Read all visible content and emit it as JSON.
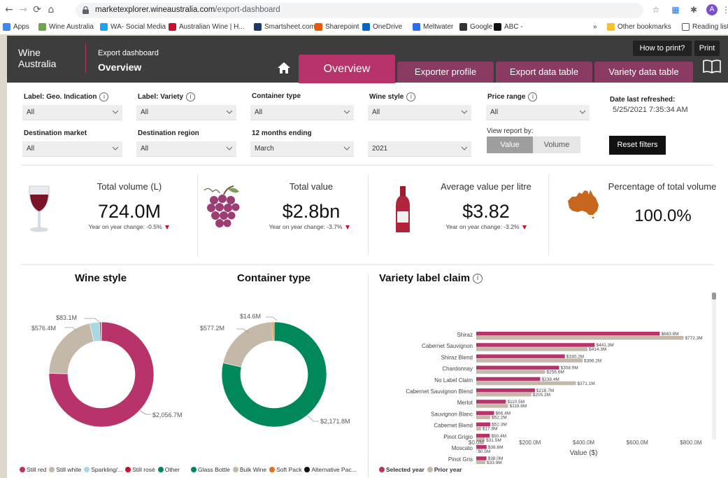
{
  "browser": {
    "url_host": "marketexplorer.wineaustralia.com",
    "url_path": "/export-dashboard",
    "profile_initial": "A",
    "bookmarks": [
      {
        "label": "Apps",
        "color": "#4285f4"
      },
      {
        "label": "Wine Australia",
        "color": "#6aa84f"
      },
      {
        "label": "WA- Social Media",
        "color": "#1da1f2"
      },
      {
        "label": "Australian Wine | H...",
        "color": "#c8102e"
      },
      {
        "label": "Smartsheet.com",
        "color": "#1b3a6b"
      },
      {
        "label": "Sharepoint",
        "color": "#e8590c"
      },
      {
        "label": "OneDrive",
        "color": "#0a64c8"
      },
      {
        "label": "Meltwater",
        "color": "#2b6cf0"
      },
      {
        "label": "Google",
        "color": "#333333"
      },
      {
        "label": "ABC -",
        "color": "#111111"
      }
    ],
    "overflow": "»",
    "other_bookmarks": "Other bookmarks",
    "reading_list": "Reading list"
  },
  "header": {
    "logo_line1": "Wine",
    "logo_line2": "Australia",
    "subtitle": "Export dashboard",
    "title": "Overview",
    "how_to_print": "How to print?",
    "print": "Print",
    "tabs": [
      "Overview",
      "Exporter profile",
      "Export data table",
      "Variety data table"
    ]
  },
  "filters": {
    "geo": {
      "label": "Label: Geo. Indication",
      "value": "All"
    },
    "variety": {
      "label": "Label: Variety",
      "value": "All"
    },
    "container": {
      "label": "Container type",
      "value": "All"
    },
    "wine_style": {
      "label": "Wine style",
      "value": "All"
    },
    "price": {
      "label": "Price range",
      "value": "All"
    },
    "date_label": "Date last refreshed:",
    "date_value": "5/25/2021 7:35:34 AM",
    "market": {
      "label": "Destination market",
      "value": "All"
    },
    "region": {
      "label": "Destination region",
      "value": "All"
    },
    "months": {
      "label": "12 months ending",
      "value": "March"
    },
    "year": {
      "value": "2021"
    },
    "view_label": "View report by:",
    "view_value": "Value",
    "view_volume": "Volume",
    "reset": "Reset filters"
  },
  "kpis": {
    "volume": {
      "title": "Total volume (L)",
      "value": "724.0M",
      "change": "Year on year change: -0.5%"
    },
    "value": {
      "title": "Total value",
      "value": "$2.8bn",
      "change": "Year on year change: -3.7%"
    },
    "avg": {
      "title": "Average value per litre",
      "value": "$3.82",
      "change": "Year on year change: -3.2%"
    },
    "pct": {
      "title": "Percentage of total volume",
      "value": "100.0%"
    }
  },
  "wine_style": {
    "title": "Wine style",
    "labels": [
      "$83.1M",
      "$576.4M",
      "$2,056.7M"
    ],
    "legend": [
      "Still red",
      "Still white",
      "Sparkling/...",
      "Still rosé",
      "Other"
    ],
    "colors": [
      "#b8336a",
      "#c4b8a8",
      "#a9d7e3",
      "#c8102e",
      "#00875a"
    ],
    "values": [
      2056.7,
      576.4,
      83.1,
      12,
      3
    ]
  },
  "container": {
    "title": "Container type",
    "labels": [
      "$14.6M",
      "$577.2M",
      "$2,171.8M"
    ],
    "legend": [
      "Glass Bottle",
      "Bulk Wine",
      "Soft Pack",
      "Alternative Pac..."
    ],
    "colors": [
      "#00875a",
      "#c4b8a8",
      "#e07020",
      "#111111"
    ],
    "values": [
      2171.8,
      577.2,
      14.6,
      2
    ]
  },
  "chart_data": {
    "type": "bar",
    "orientation": "horizontal",
    "title": "Variety label claim",
    "xlabel": "Value ($)",
    "xlim": [
      0,
      800
    ],
    "ticks": [
      "$0.0M",
      "$200.0M",
      "$400.0M",
      "$600.0M",
      "$800.0M"
    ],
    "categories": [
      "Shiraz",
      "Cabernet Sauvignon",
      "Shiraz Blend",
      "Chardonnay",
      "No Label Claim",
      "Cabernet Sauvignon Blend",
      "Merlot",
      "Sauvignon Blanc",
      "Cabernet Blend",
      "Pinot Grigio",
      "Moscato",
      "Pinot Gris"
    ],
    "series": [
      {
        "name": "Selected year",
        "color": "#b8336a",
        "values": [
          683.8,
          441.3,
          330.2,
          308.9,
          238.4,
          218.7,
          110.5,
          66.4,
          52.3,
          50.4,
          38.6,
          38.0
        ],
        "labels": [
          "$683.8M",
          "$441.3M",
          "$330.2M",
          "$308.9M",
          "$238.4M",
          "$218.7M",
          "$110.5M",
          "$66.4M",
          "$52.3M",
          "$50.4M",
          "$38.6M",
          "$38.0M"
        ]
      },
      {
        "name": "Prior year",
        "color": "#c4b8a8",
        "values": [
          772.3,
          414.3,
          396.2,
          256.6,
          371.1,
          205.2,
          118.6,
          52.2,
          17.8,
          31.5,
          0.5,
          33.9
        ],
        "labels": [
          "$772.3M",
          "$414.3M",
          "$396.2M",
          "$256.6M",
          "$371.1M",
          "$205.2M",
          "$118.6M",
          "$52.2M",
          "$17.8M",
          "$31.5M",
          "$0.5M",
          "$33.9M"
        ]
      }
    ]
  }
}
